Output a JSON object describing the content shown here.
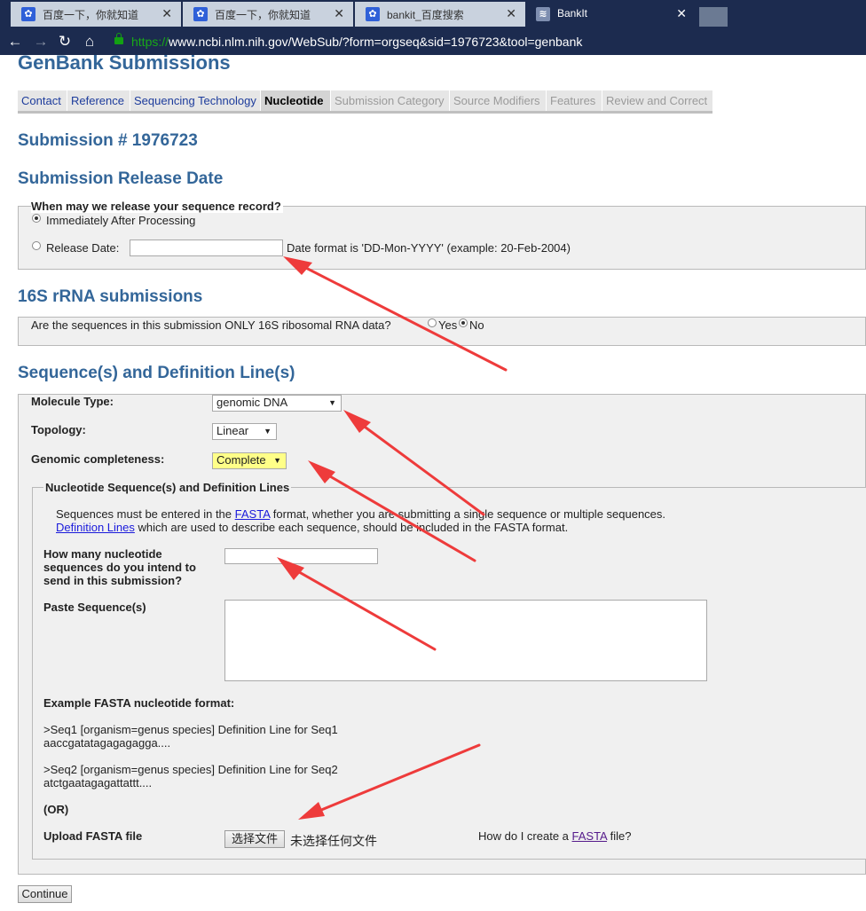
{
  "browser": {
    "tabs": [
      {
        "label": "百度一下，你就知道",
        "active": false
      },
      {
        "label": "百度一下，你就知道",
        "active": false
      },
      {
        "label": "bankit_百度搜索",
        "active": false
      },
      {
        "label": "BankIt",
        "active": true
      }
    ],
    "url_protocol": "https://",
    "url_rest": "www.ncbi.nlm.nih.gov/WebSub/?form=orgseq&sid=1976723&tool=genbank"
  },
  "page": {
    "title": "GenBank Submissions",
    "steps": [
      {
        "label": "Contact",
        "state": "done"
      },
      {
        "label": "Reference",
        "state": "done"
      },
      {
        "label": "Sequencing Technology",
        "state": "done"
      },
      {
        "label": "Nucleotide",
        "state": "current"
      },
      {
        "label": "Submission Category",
        "state": "todo"
      },
      {
        "label": "Source Modifiers",
        "state": "todo"
      },
      {
        "label": "Features",
        "state": "todo"
      },
      {
        "label": "Review and Correct",
        "state": "todo"
      }
    ],
    "submission_heading": "Submission # 1976723"
  },
  "release": {
    "heading": "Submission Release Date",
    "question": "When may we release your sequence record?",
    "option_immediate": "Immediately After Processing",
    "option_date": "Release Date:",
    "date_value": "",
    "date_hint": "Date format is 'DD-Mon-YYYY' (example: 20-Feb-2004)"
  },
  "rrna": {
    "heading": "16S rRNA submissions",
    "question": "Are the sequences in this submission ONLY 16S ribosomal RNA data?",
    "yes": "Yes",
    "no": "No"
  },
  "sequence": {
    "heading": "Sequence(s) and Definition Line(s)",
    "molecule_label": "Molecule Type:",
    "molecule_value": "genomic DNA",
    "topology_label": "Topology:",
    "topology_value": "Linear",
    "completeness_label": "Genomic completeness:",
    "completeness_value": "Complete",
    "inner_title": "Nucleotide Sequence(s) and Definition Lines",
    "info_pre": "Sequences must be entered in the",
    "info_link1": "FASTA",
    "info_mid": "format, whether you are submitting a single sequence or multiple sequences.",
    "info_link2": "Definition Lines",
    "info_post": "which are used to describe each sequence, should be included in the FASTA format.",
    "count_label_1": "How many nucleotide",
    "count_label_2": "sequences do you intend to",
    "count_label_3": "send in this submission?",
    "count_value": "",
    "paste_label": "Paste Sequence(s)",
    "example_heading": "Example FASTA nucleotide format:",
    "ex1_def": ">Seq1 [organism=genus species] Definition Line for Seq1",
    "ex1_seq": "aaccgatatagagagagga....",
    "ex2_def": ">Seq2 [organism=genus species] Definition Line for Seq2",
    "ex2_seq": "atctgaatagagattattt....",
    "or_label": "(OR)",
    "upload_label": "Upload FASTA file",
    "choose_file": "选择文件",
    "no_file": "未选择任何文件",
    "howto_pre": "How do I create a",
    "howto_link": "FASTA",
    "howto_post": "file?"
  },
  "continue_label": "Continue",
  "colors": {
    "heading": "#336699",
    "arrow": "#ee3b3b",
    "chrome": "#1c2b4f"
  }
}
